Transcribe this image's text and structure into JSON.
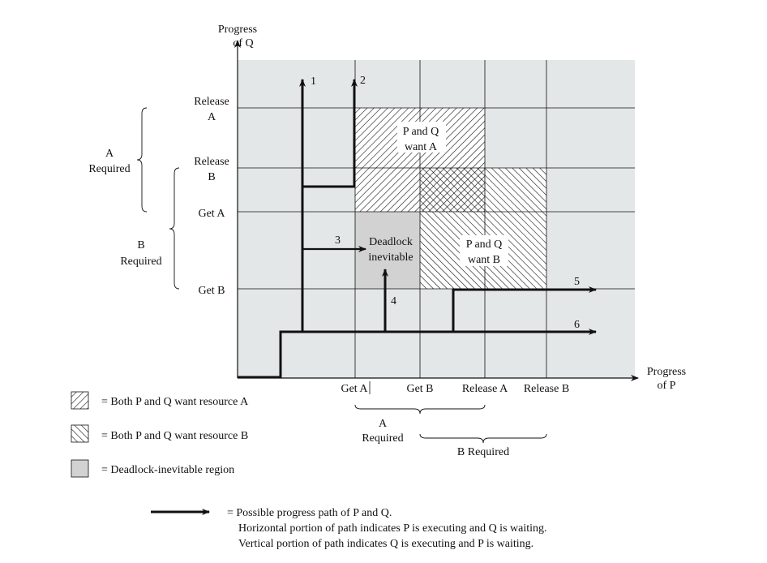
{
  "axes": {
    "y_title": [
      "Progress",
      "of Q"
    ],
    "x_title": [
      "Progress",
      "of P"
    ],
    "y_ticks": [
      [
        "Release",
        "A"
      ],
      [
        "Release",
        "B"
      ],
      [
        "Get A"
      ],
      [
        "Get B"
      ]
    ],
    "x_ticks": [
      "Get A",
      "Get B",
      "Release A",
      "Release B"
    ]
  },
  "braces": {
    "q_a_required": [
      "A",
      "Required"
    ],
    "q_b_required": [
      "B",
      "Required"
    ],
    "p_a_required": [
      "A",
      "Required"
    ],
    "p_b_required": "B Required"
  },
  "regions": {
    "want_a": [
      "P and Q",
      "want A"
    ],
    "want_b": [
      "P and Q",
      "want B"
    ],
    "deadlock": [
      "Deadlock",
      "inevitable"
    ]
  },
  "paths": [
    "1",
    "2",
    "3",
    "4",
    "5",
    "6"
  ],
  "legend": {
    "want_a": "= Both P and Q want resource A",
    "want_b": "= Both P and Q want resource B",
    "deadlock": "= Deadlock-inevitable region",
    "path": [
      "= Possible progress path of P and Q.",
      "Horizontal portion of path indicates P is executing and Q is waiting.",
      "Vertical portion of path indicates Q is executing and P is waiting."
    ]
  },
  "colors": {
    "background": "#e3e7e8",
    "deadlock": "#d2d2d2",
    "line": "#111111"
  }
}
